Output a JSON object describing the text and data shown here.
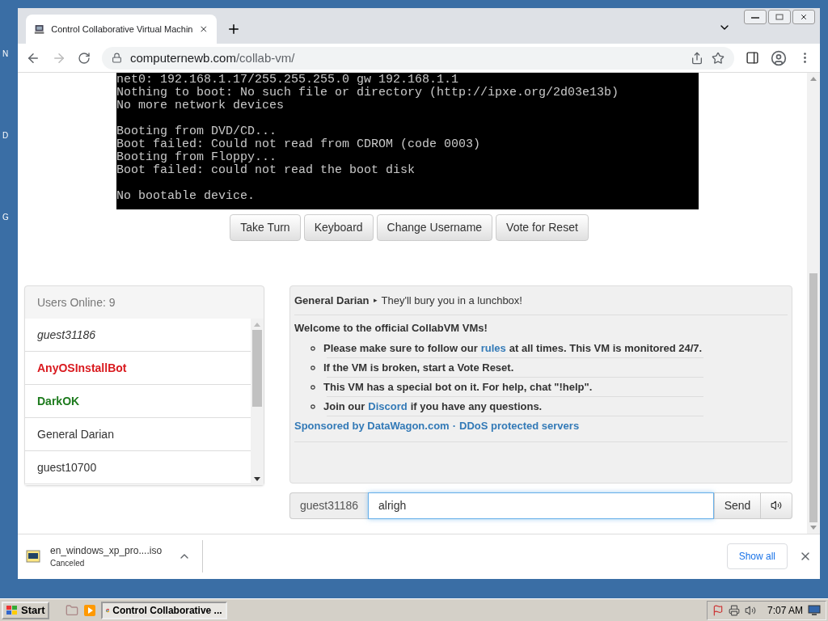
{
  "desktop": {
    "icon_labels": [
      "N",
      "D",
      "G"
    ]
  },
  "browser": {
    "tab": {
      "title": "Control Collaborative Virtual Machin",
      "selected": true
    },
    "address": {
      "domain": "computernewb.com",
      "path": "/collab-vm/"
    }
  },
  "vm_screen": {
    "blocks": [
      [
        "net0: 192.168.1.17/255.255.255.0 gw 192.168.1.1",
        "Nothing to boot: No such file or directory (http://ipxe.org/2d03e13b)",
        "No more network devices"
      ],
      [
        "Booting from DVD/CD...",
        "Boot failed: Could not read from CDROM (code 0003)",
        "Booting from Floppy...",
        "Boot failed: could not read the boot disk"
      ],
      [
        "No bootable device."
      ]
    ]
  },
  "vm_buttons": [
    "Take Turn",
    "Keyboard",
    "Change Username",
    "Vote for Reset"
  ],
  "users": {
    "header": "Users Online: 9",
    "items": [
      {
        "name": "guest31186",
        "kind": "self"
      },
      {
        "name": "AnyOSInstallBot",
        "kind": "admin"
      },
      {
        "name": "DarkOK",
        "kind": "moderator"
      },
      {
        "name": "General Darian",
        "kind": "user"
      },
      {
        "name": "guest10700",
        "kind": "user"
      }
    ]
  },
  "chat": {
    "message": {
      "user": "General Darian",
      "arrow": "▸",
      "text": "They'll bury you in a lunchbox!"
    },
    "welcome": {
      "title": "Welcome to the official CollabVM VMs!",
      "items": [
        [
          {
            "text": "Please make sure to follow our",
            "link": false
          },
          {
            "text": "rules",
            "link": true
          },
          {
            "text": "at all times. This VM is monitored 24/7.",
            "link": false
          }
        ],
        [
          {
            "text": "If the VM is broken, start a Vote Reset.",
            "link": false
          }
        ],
        [
          {
            "text": "This VM has a special bot on it. For help, chat \"!help\".",
            "link": false
          }
        ],
        [
          {
            "text": "Join our",
            "link": false
          },
          {
            "text": "Discord",
            "link": true
          },
          {
            "text": "if you have any questions.",
            "link": false
          }
        ]
      ],
      "sponsor": {
        "first": "Sponsored by DataWagon.com",
        "separator": "·",
        "second": "DDoS protected servers"
      }
    }
  },
  "chat_input": {
    "username": "guest31186",
    "value": "alrigh",
    "send": "Send"
  },
  "download": {
    "file": "en_windows_xp_pro....iso",
    "status": "Canceled",
    "show_all": "Show all"
  },
  "taskbar": {
    "start": "Start",
    "task": "Control Collaborative ...",
    "time": "7:07 AM"
  }
}
